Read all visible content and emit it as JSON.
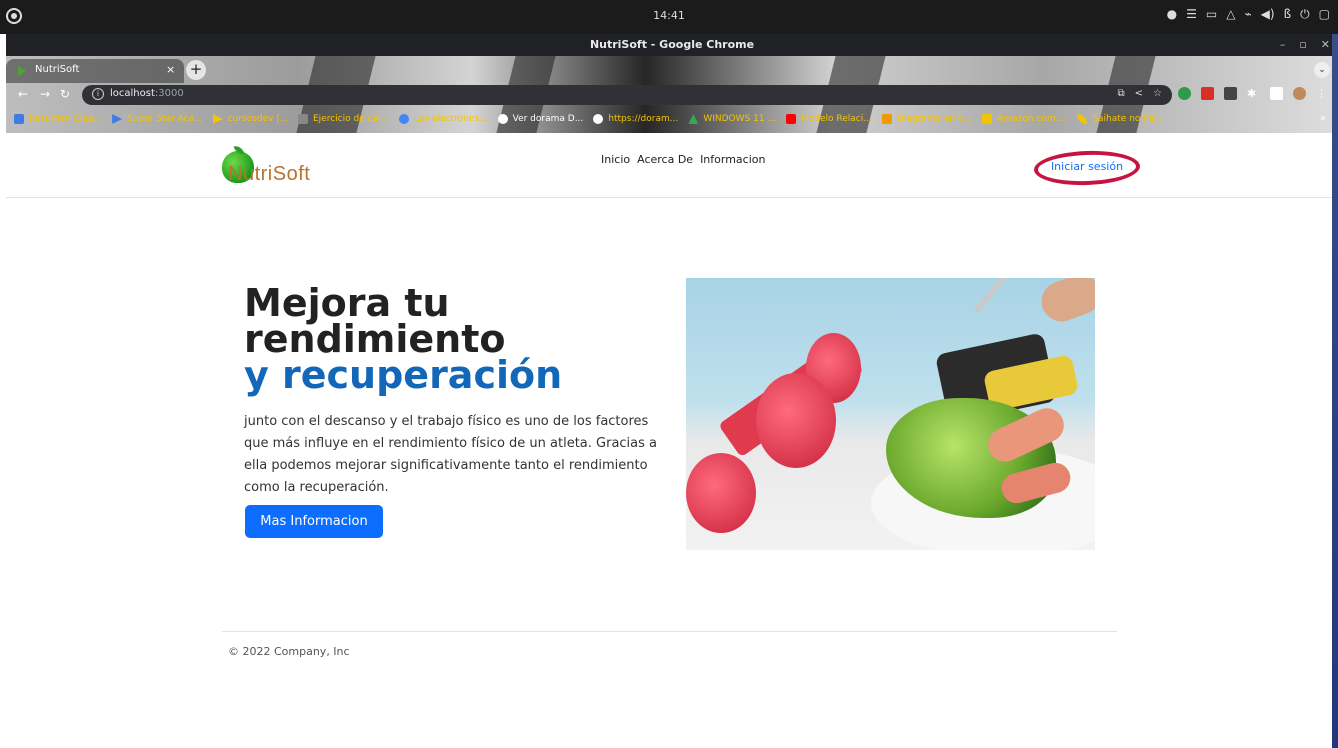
{
  "os": {
    "clock": "14:41"
  },
  "window": {
    "title": "NutriSoft - Google Chrome"
  },
  "browser": {
    "tab_title": "NutriSoft",
    "tab_close": "×",
    "new_tab": "+",
    "url_host": "localhost",
    "url_port": ":3000",
    "bookmarks": [
      {
        "label": "Resumen Clea...",
        "icon": "s-icon",
        "color": "#3f7be0"
      },
      {
        "label": "Super Star Aca...",
        "icon": "play-icon",
        "color": "#3f7be0"
      },
      {
        "label": "cursosdev |...",
        "icon": "chevron-icon",
        "color": "#f5c400"
      },
      {
        "label": "Ejercicio de cal...",
        "icon": "doc-icon",
        "color": "#888888"
      },
      {
        "label": "Los electrones...",
        "icon": "google-icon",
        "color": "#4285f4"
      },
      {
        "label": "Ver dorama D...",
        "icon": "globe-icon",
        "color": "#ffffff"
      },
      {
        "label": "https://doram...",
        "icon": "globe-icon",
        "color": "#ffffff"
      },
      {
        "label": "WINDOWS 11 ...",
        "icon": "drive-icon",
        "color": "#34a853"
      },
      {
        "label": "Modelo Relaci...",
        "icon": "youtube-icon",
        "color": "#ff0000"
      },
      {
        "label": "Diagrama en b...",
        "icon": "puzzle-icon",
        "color": "#f29900"
      },
      {
        "label": "Amazon.com:...",
        "icon": "amazon-icon",
        "color": "#f5c400"
      },
      {
        "label": "Saihate no Pal...",
        "icon": "leaf-icon",
        "color": "#f5c400"
      }
    ],
    "bookmarks_overflow": "»"
  },
  "site": {
    "brand": "NutriSoft",
    "nav": [
      "Inicio",
      "Acerca De",
      "Informacion"
    ],
    "login_label": "Iniciar sesión",
    "hero": {
      "title_line1": "Mejora tu",
      "title_line2": "rendimiento",
      "title_line3": "y recuperación",
      "body": "junto con el descanso y el trabajo físico es uno de los factores que más influye en el rendimiento físico de un atleta. Gracias a ella podemos mejorar significativamente tanto el rendimiento como la recuperación.",
      "cta_label": "Mas Informacion"
    },
    "footer": "© 2022 Company, Inc"
  },
  "colors": {
    "primary": "#0d6efd",
    "accent_blue": "#1267b8",
    "login_ring": "#c8123f",
    "brand_text": "#b8732e"
  }
}
